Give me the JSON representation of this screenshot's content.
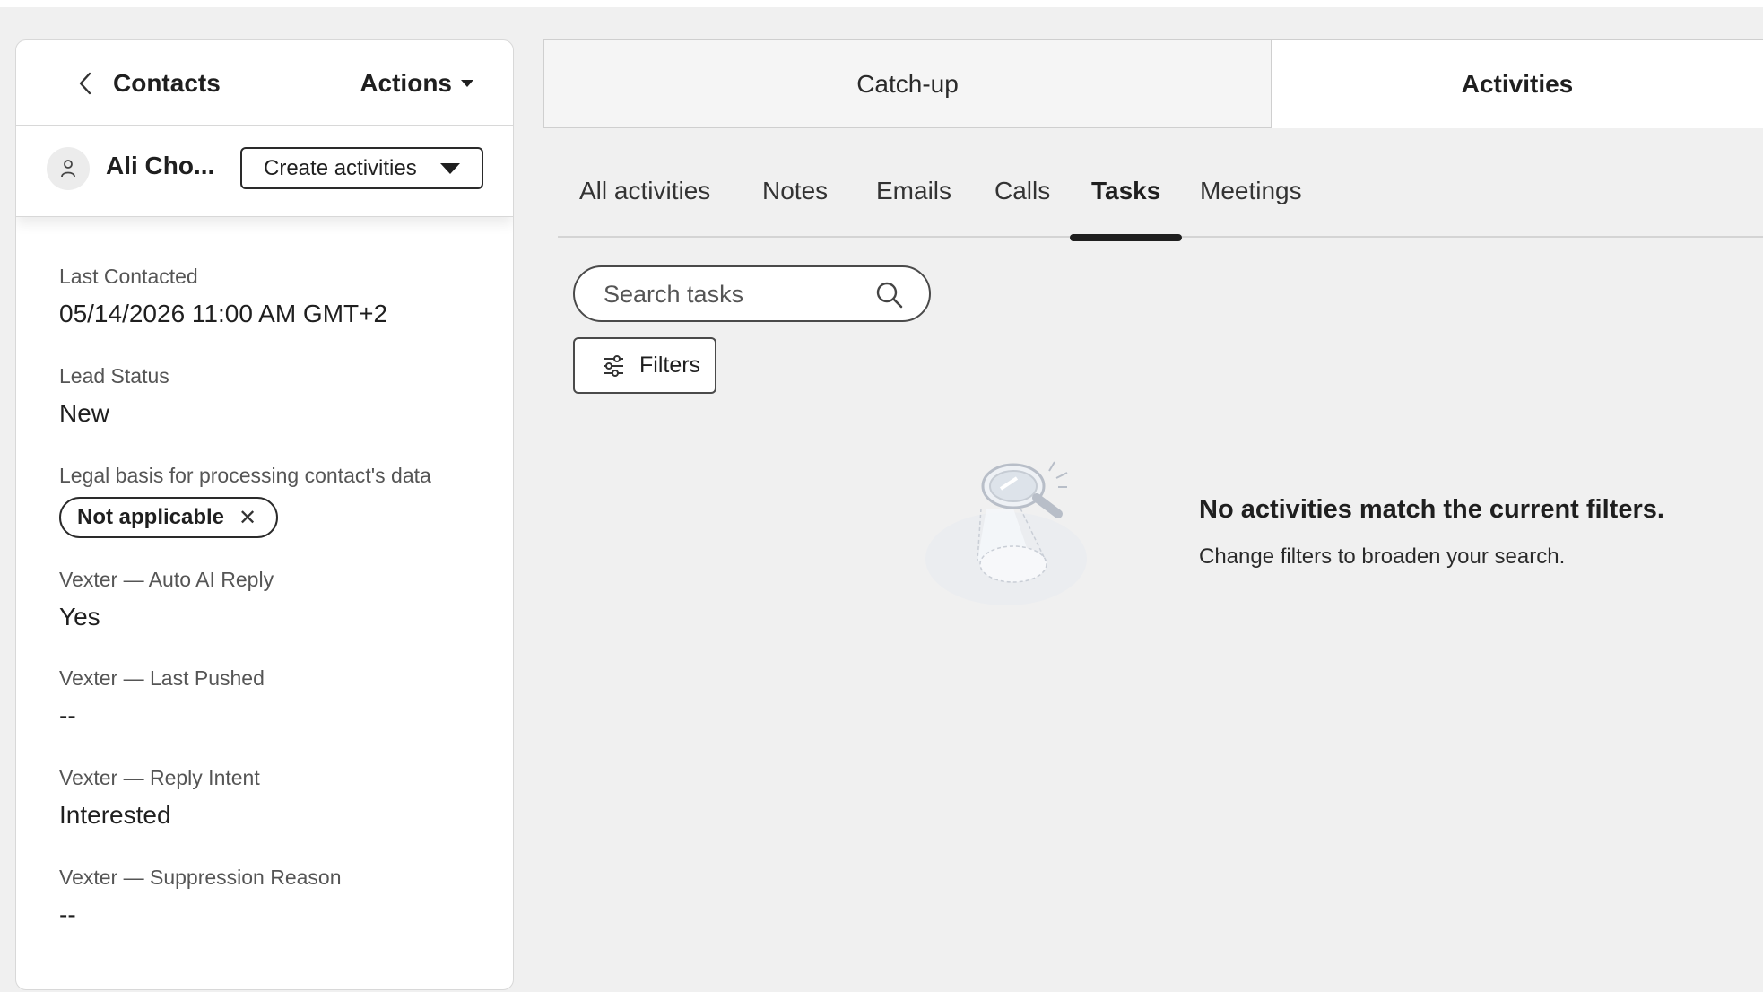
{
  "header": {
    "back_label": "Contacts",
    "actions_label": "Actions"
  },
  "contact": {
    "name": "Ali Cho...",
    "create_label": "Create activities"
  },
  "properties": [
    {
      "label": "Last Contacted",
      "value": "05/14/2026 11:00 AM GMT+2"
    },
    {
      "label": "Lead Status",
      "value": "New"
    },
    {
      "label": "Legal basis for processing contact's data",
      "chip": "Not applicable"
    },
    {
      "label": "Vexter — Auto AI Reply",
      "value": "Yes"
    },
    {
      "label": "Vexter — Last Pushed",
      "value": "--"
    },
    {
      "label": "Vexter — Reply Intent",
      "value": "Interested"
    },
    {
      "label": "Vexter — Suppression Reason",
      "value": "--"
    }
  ],
  "top_tabs": [
    {
      "label": "Catch-up",
      "active": false
    },
    {
      "label": "Activities",
      "active": true
    }
  ],
  "sub_tabs": [
    {
      "label": "All activities"
    },
    {
      "label": "Notes"
    },
    {
      "label": "Emails"
    },
    {
      "label": "Calls"
    },
    {
      "label": "Tasks",
      "active": true
    },
    {
      "label": "Meetings"
    }
  ],
  "search": {
    "placeholder": "Search tasks",
    "value": ""
  },
  "filters_label": "Filters",
  "empty_state": {
    "title": "No activities match the current filters.",
    "subtitle": "Change filters to broaden your search."
  },
  "colors": {
    "page_bg": "#f0f0f0",
    "panel_bg": "#ffffff",
    "text": "#1f1f1f",
    "muted": "#555555",
    "accent": "#1f1f1f"
  }
}
